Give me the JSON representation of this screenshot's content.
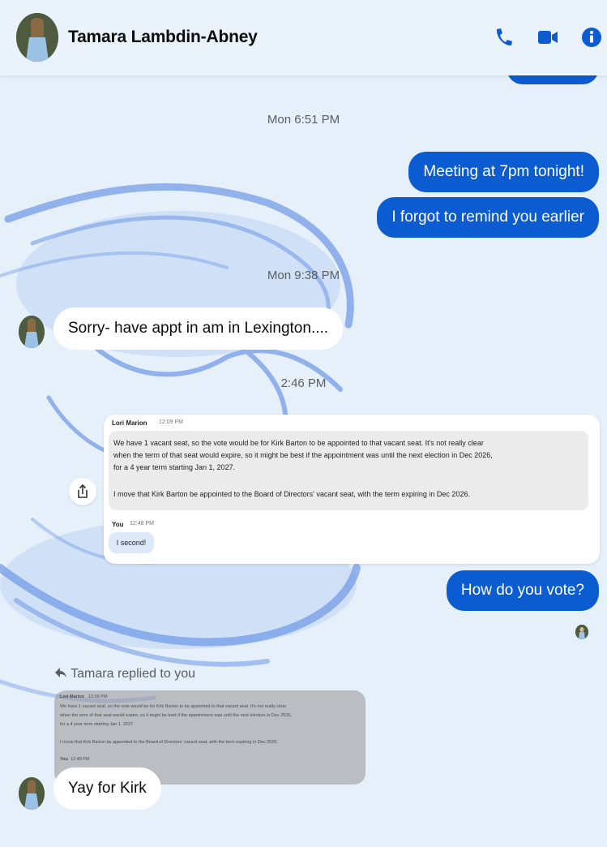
{
  "header": {
    "contact_name": "Tamara Lambdin-Abney"
  },
  "icons": {
    "call": "phone-icon",
    "video": "video-camera-icon",
    "info": "info-icon",
    "share": "share-icon",
    "reply": "reply-arrow-icon"
  },
  "colors": {
    "accent": "#0b5bd1",
    "background": "#e6f0fb",
    "incoming_bubble": "#ffffff"
  },
  "messages": {
    "ts1": "Mon 6:51 PM",
    "out1": "Meeting at 7pm tonight!",
    "out2": "I forgot to remind you earlier",
    "ts2": "Mon 9:38 PM",
    "in1": "Sorry- have appt in am in Lexington....",
    "ts3": "2:46 PM",
    "out3": "How do you vote?",
    "replied_label": "Tamara replied to you",
    "in2": "Yay for Kirk"
  },
  "shared": {
    "author": "Lori Marion",
    "author_time": "12:09 PM",
    "lines": [
      "We have 1 vacant seat, so the vote would be for Kirk Barton to be appointed to that vacant seat.  It's not really clear",
      "when the term of that seat would expire, so it might be best if the appointment was until the next election in Dec 2026,",
      "for a 4 year term starting Jan 1, 2027.",
      "I move that Kirk Barton be appointed to the Board of Directors' vacant seat, with the term expiring in Dec 2026."
    ],
    "you_label": "You",
    "you_time": "12:48 PM",
    "you_reply": "I second!"
  },
  "reply_preview": {
    "author": "Lori Marion",
    "author_time": "12:09 PM",
    "lines": [
      "We have 1 vacant seat, so the vote would be for Kirk Barton to be appointed to that vacant seat.  It's not really clear",
      "when the term of that seat would expire, so it might be best if the appointment was until the next election in Dec 2026,",
      "for a 4 year term starting Jan 1, 2027.",
      "I move that Kirk Barton be appointed to the Board of Directors' vacant seat, with the term expiring in Dec 2026."
    ],
    "you_label": "You",
    "you_time": "12:48 PM"
  }
}
